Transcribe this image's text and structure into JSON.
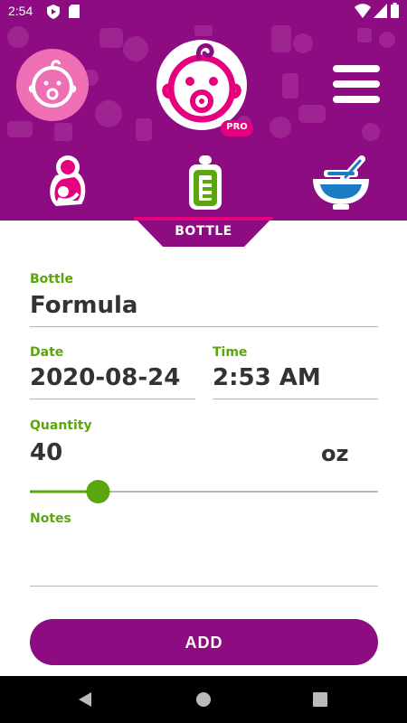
{
  "status_bar": {
    "time": "2:54"
  },
  "header": {
    "logo_badge": "PRO"
  },
  "tabs": {
    "active_label": "BOTTLE"
  },
  "form": {
    "bottle": {
      "label": "Bottle",
      "value": "Formula"
    },
    "date": {
      "label": "Date",
      "value": "2020-08-24"
    },
    "time": {
      "label": "Time",
      "value": "2:53 AM"
    },
    "quantity": {
      "label": "Quantity",
      "value": "40",
      "unit": "oz",
      "slider_fraction": 0.196
    },
    "notes": {
      "label": "Notes",
      "value": ""
    }
  },
  "add_button": {
    "label": "ADD"
  },
  "colors": {
    "brand": "#8e0c82",
    "accent_green": "#5aa70c",
    "pink": "#ef6fb4",
    "blue": "#1c7bc3"
  },
  "icons": [
    "wifi-icon",
    "signal-icon",
    "battery-icon",
    "baby-face-icon",
    "menu-icon",
    "breastfeeding-icon",
    "bottle-icon",
    "food-bowl-icon",
    "back-icon",
    "home-icon",
    "recents-icon"
  ]
}
